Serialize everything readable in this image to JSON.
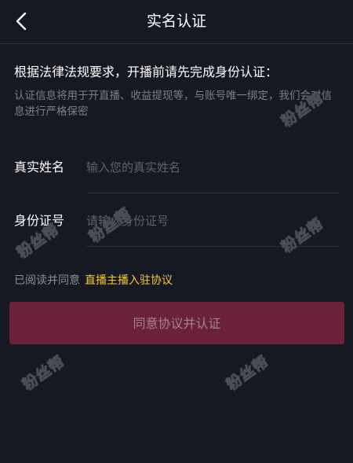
{
  "header": {
    "back_icon": "chevron-left-icon",
    "title": "实名认证"
  },
  "notice": {
    "main": "根据法律法规要求，开播前请先完成身份认证：",
    "sub": "认证信息将用于开直播、收益提现等，与账号唯一绑定，我们会对信息进行严格保密"
  },
  "form": {
    "name": {
      "label": "真实姓名",
      "value": "",
      "placeholder": "输入您的真实姓名"
    },
    "id": {
      "label": "身份证号",
      "value": "",
      "placeholder": "请输入身份证号"
    }
  },
  "agreement": {
    "prefix": "已阅读并同意",
    "link": "直播主播入驻协议"
  },
  "submit_label": "同意协议并认证",
  "watermark": "粉丝帮",
  "colors": {
    "background": "#161823",
    "accent_link": "#f5c93b",
    "button_bg": "#6b2138",
    "button_text": "#a3828c"
  }
}
